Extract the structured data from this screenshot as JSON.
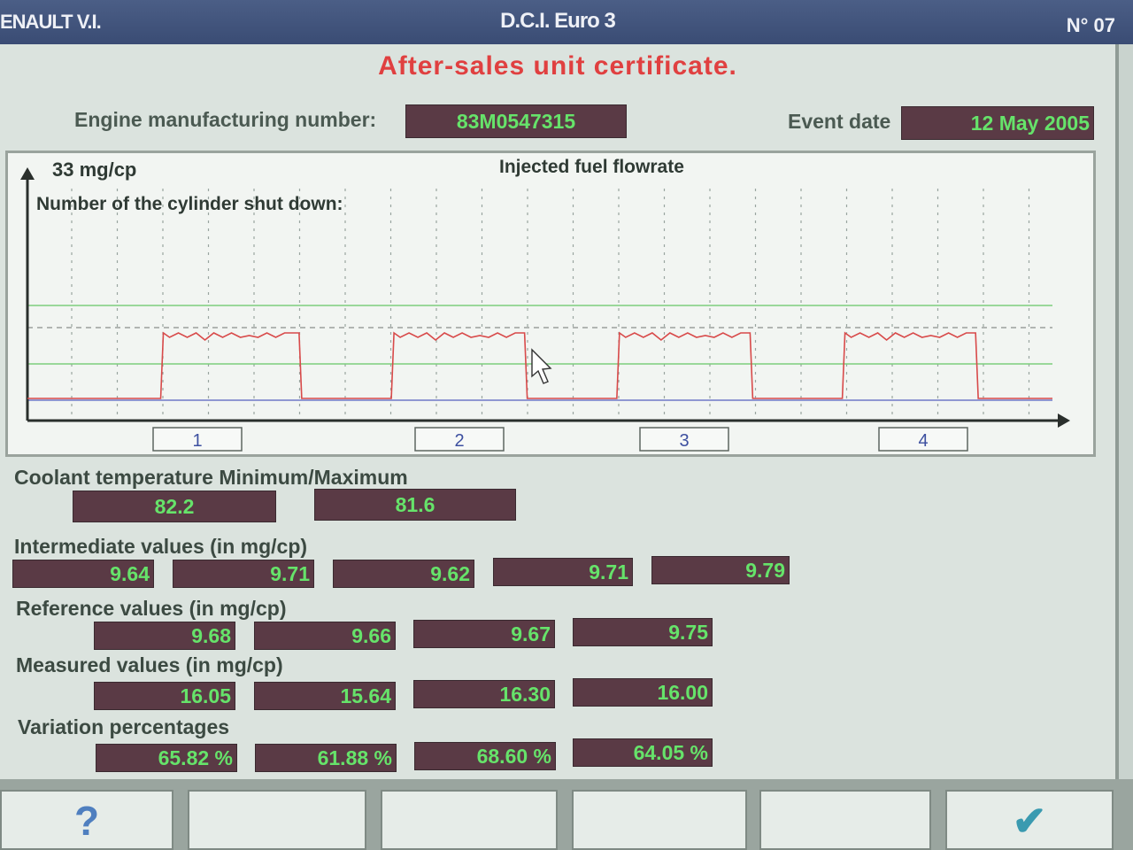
{
  "titlebar": {
    "left": "ENAULT V.I.",
    "center": "D.C.I. Euro 3",
    "right": "N° 07"
  },
  "certificate_title": "After-sales unit certificate.",
  "engine": {
    "label": "Engine manufacturing number:",
    "value": "83M0547315"
  },
  "event": {
    "label": "Event date",
    "value": "12 May 2005"
  },
  "chart": {
    "title": "Injected fuel flowrate",
    "y_label": "33 mg/cp",
    "subtitle": "Number of the cylinder shut down:",
    "cylinders": [
      "1",
      "2",
      "3",
      "4"
    ]
  },
  "chart_data": {
    "type": "line",
    "title": "Injected fuel flowrate",
    "ylabel": "33 mg/cp",
    "series": [
      {
        "name": "flowrate",
        "color": "#d84a4a",
        "segments": [
          [
            0.13,
            0.265
          ],
          [
            0.355,
            0.485
          ],
          [
            0.575,
            0.705
          ],
          [
            0.795,
            0.925
          ]
        ]
      }
    ],
    "reference_lines": [
      "upper",
      "middle",
      "lower"
    ],
    "grid": true
  },
  "coolant": {
    "label": "Coolant temperature Minimum/Maximum",
    "min": "82.2",
    "max": "81.6"
  },
  "intermediate": {
    "label": "Intermediate values (in mg/cp)",
    "values": [
      "9.64",
      "9.71",
      "9.62",
      "9.71",
      "9.79"
    ]
  },
  "reference": {
    "label": "Reference values (in mg/cp)",
    "values": [
      "9.68",
      "9.66",
      "9.67",
      "9.75"
    ]
  },
  "measured": {
    "label": "Measured values (in mg/cp)",
    "values": [
      "16.05",
      "15.64",
      "16.30",
      "16.00"
    ]
  },
  "variation": {
    "label": "Variation percentages",
    "values": [
      "65.82 %",
      "61.88 %",
      "68.60 %",
      "64.05 %"
    ]
  },
  "buttons": {
    "help": "?",
    "ok": "✔"
  },
  "colors": {
    "accent_red": "#e04040",
    "lcd_bg": "#5a3a45",
    "lcd_text": "#66e36a"
  }
}
